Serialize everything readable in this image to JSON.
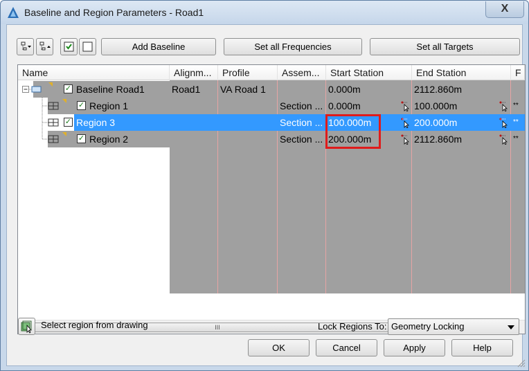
{
  "window": {
    "title": "Baseline and Region Parameters - Road1",
    "close_glyph": "X"
  },
  "toolbar": {
    "add_baseline": "Add Baseline",
    "set_all_frequencies": "Set all Frequencies",
    "set_all_targets": "Set all Targets",
    "icons": [
      "expand-tree-icon",
      "collapse-tree-icon",
      "check-all-icon",
      "uncheck-all-icon"
    ]
  },
  "grid": {
    "columns": [
      "Name",
      "Alignm...",
      "Profile",
      "Assem...",
      "Start Station",
      "End Station",
      "F"
    ],
    "rows": [
      {
        "name": "Baseline Road1",
        "alignment": "Road1",
        "profile": "VA Road 1",
        "assembly": "",
        "start": "0.000m",
        "end": "2112.860m",
        "checked": true,
        "level": 0,
        "selected": false
      },
      {
        "name": "Region 1",
        "alignment": "",
        "profile": "",
        "assembly": "Section ...",
        "start": "0.000m",
        "end": "100.000m",
        "checked": true,
        "level": 1,
        "selected": false
      },
      {
        "name": "Region 3",
        "alignment": "",
        "profile": "",
        "assembly": "Section ...",
        "start": "100.000m",
        "end": "200.000m",
        "checked": true,
        "level": 1,
        "selected": true
      },
      {
        "name": "Region 2",
        "alignment": "",
        "profile": "",
        "assembly": "Section ...",
        "start": "200.000m",
        "end": "2112.860m",
        "checked": true,
        "level": 1,
        "selected": false
      }
    ],
    "scroll_thumb_glyph": "III"
  },
  "bottom": {
    "select_region": "Select region from drawing",
    "lock_label": "Lock Regions To:",
    "lock_value": "Geometry Locking",
    "ok": "OK",
    "cancel": "Cancel",
    "apply": "Apply",
    "help": "Help"
  },
  "colors": {
    "selection": "#3399ff",
    "grid_fill": "#a0a0a0",
    "highlight_box": "#e01b1b"
  }
}
